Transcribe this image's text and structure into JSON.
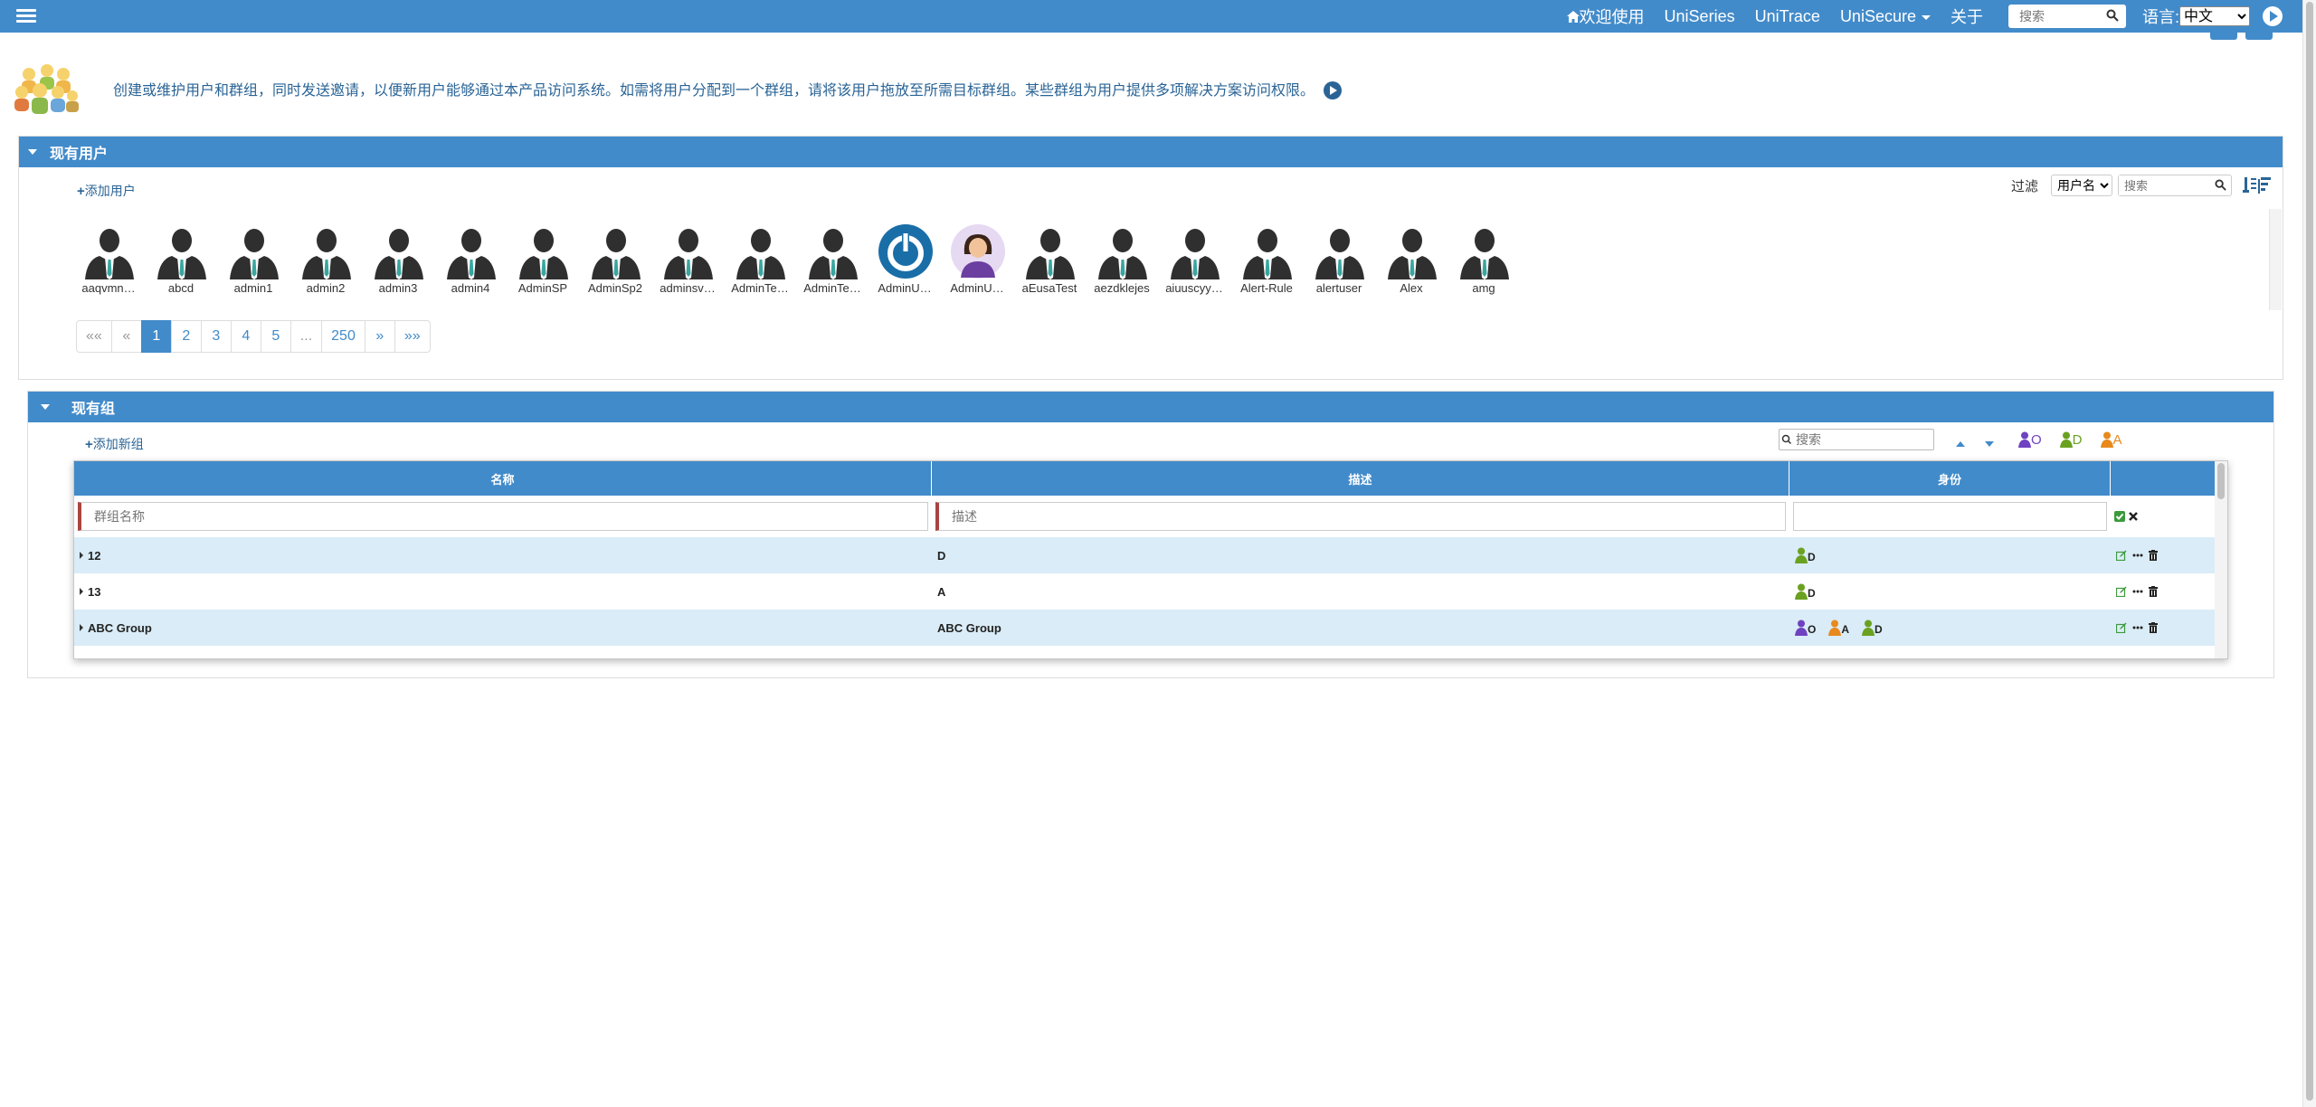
{
  "navbar": {
    "welcome": "欢迎使用",
    "links": [
      "UniSeries",
      "UniTrace"
    ],
    "unisecure": "UniSecure",
    "about": "关于",
    "search_placeholder": "搜索",
    "lang_label": "语言:",
    "lang_value": "中文"
  },
  "intro": {
    "text": "创建或维护用户和群组，同时发送邀请，以便新用户能够通过本产品访问系统。如需将用户分配到一个群组，请将该用户拖放至所需目标群组。某些群组为用户提供多项解决方案访问权限。"
  },
  "users_panel": {
    "title": "现有用户",
    "add_user": "添加用户",
    "filter_label": "过滤",
    "filter_select": "用户名",
    "search_placeholder": "搜索",
    "users": [
      {
        "name": "aaqvmn…",
        "avatar": "person-silhouette-icon"
      },
      {
        "name": "abcd",
        "avatar": "person-silhouette-icon"
      },
      {
        "name": "admin1",
        "avatar": "person-silhouette-icon"
      },
      {
        "name": "admin2",
        "avatar": "person-silhouette-icon"
      },
      {
        "name": "admin3",
        "avatar": "person-silhouette-icon"
      },
      {
        "name": "admin4",
        "avatar": "person-silhouette-icon"
      },
      {
        "name": "AdminSP",
        "avatar": "person-silhouette-icon"
      },
      {
        "name": "AdminSp2",
        "avatar": "person-silhouette-icon"
      },
      {
        "name": "adminsv…",
        "avatar": "person-silhouette-icon"
      },
      {
        "name": "AdminTe…",
        "avatar": "person-silhouette-icon"
      },
      {
        "name": "AdminTe…",
        "avatar": "person-silhouette-icon"
      },
      {
        "name": "AdminU…",
        "avatar": "power-logo-icon"
      },
      {
        "name": "AdminU…",
        "avatar": "woman-avatar-icon"
      },
      {
        "name": "aEusaTest",
        "avatar": "person-silhouette-icon"
      },
      {
        "name": "aezdklejes",
        "avatar": "person-silhouette-icon"
      },
      {
        "name": "aiuuscyy…",
        "avatar": "person-silhouette-icon"
      },
      {
        "name": "Alert-Rule",
        "avatar": "person-silhouette-icon"
      },
      {
        "name": "alertuser",
        "avatar": "person-silhouette-icon"
      },
      {
        "name": "Alex",
        "avatar": "person-silhouette-icon"
      },
      {
        "name": "amg",
        "avatar": "person-silhouette-icon"
      }
    ],
    "pagination": {
      "first": "««",
      "prev": "«",
      "pages": [
        "1",
        "2",
        "3",
        "4",
        "5"
      ],
      "ellipsis": "...",
      "last_page": "250",
      "next": "»",
      "last": "»»",
      "current": "1"
    }
  },
  "groups_panel": {
    "title": "现有组",
    "add_group": "添加新组",
    "search_placeholder": "搜索",
    "legend": [
      {
        "label": "O",
        "color": "#6f42c1"
      },
      {
        "label": "D",
        "color": "#6aa121"
      },
      {
        "label": "A",
        "color": "#e8891d"
      }
    ],
    "columns": [
      "名称",
      "描述",
      "身份",
      ""
    ],
    "filter_name_placeholder": "群组名称",
    "filter_desc_placeholder": "描述",
    "rows": [
      {
        "name": "12",
        "description": "D",
        "roles": [
          "D"
        ]
      },
      {
        "name": "13",
        "description": "A",
        "roles": [
          "D"
        ]
      },
      {
        "name": "ABC Group",
        "description": "ABC Group",
        "roles": [
          "O",
          "A",
          "D"
        ]
      }
    ]
  }
}
